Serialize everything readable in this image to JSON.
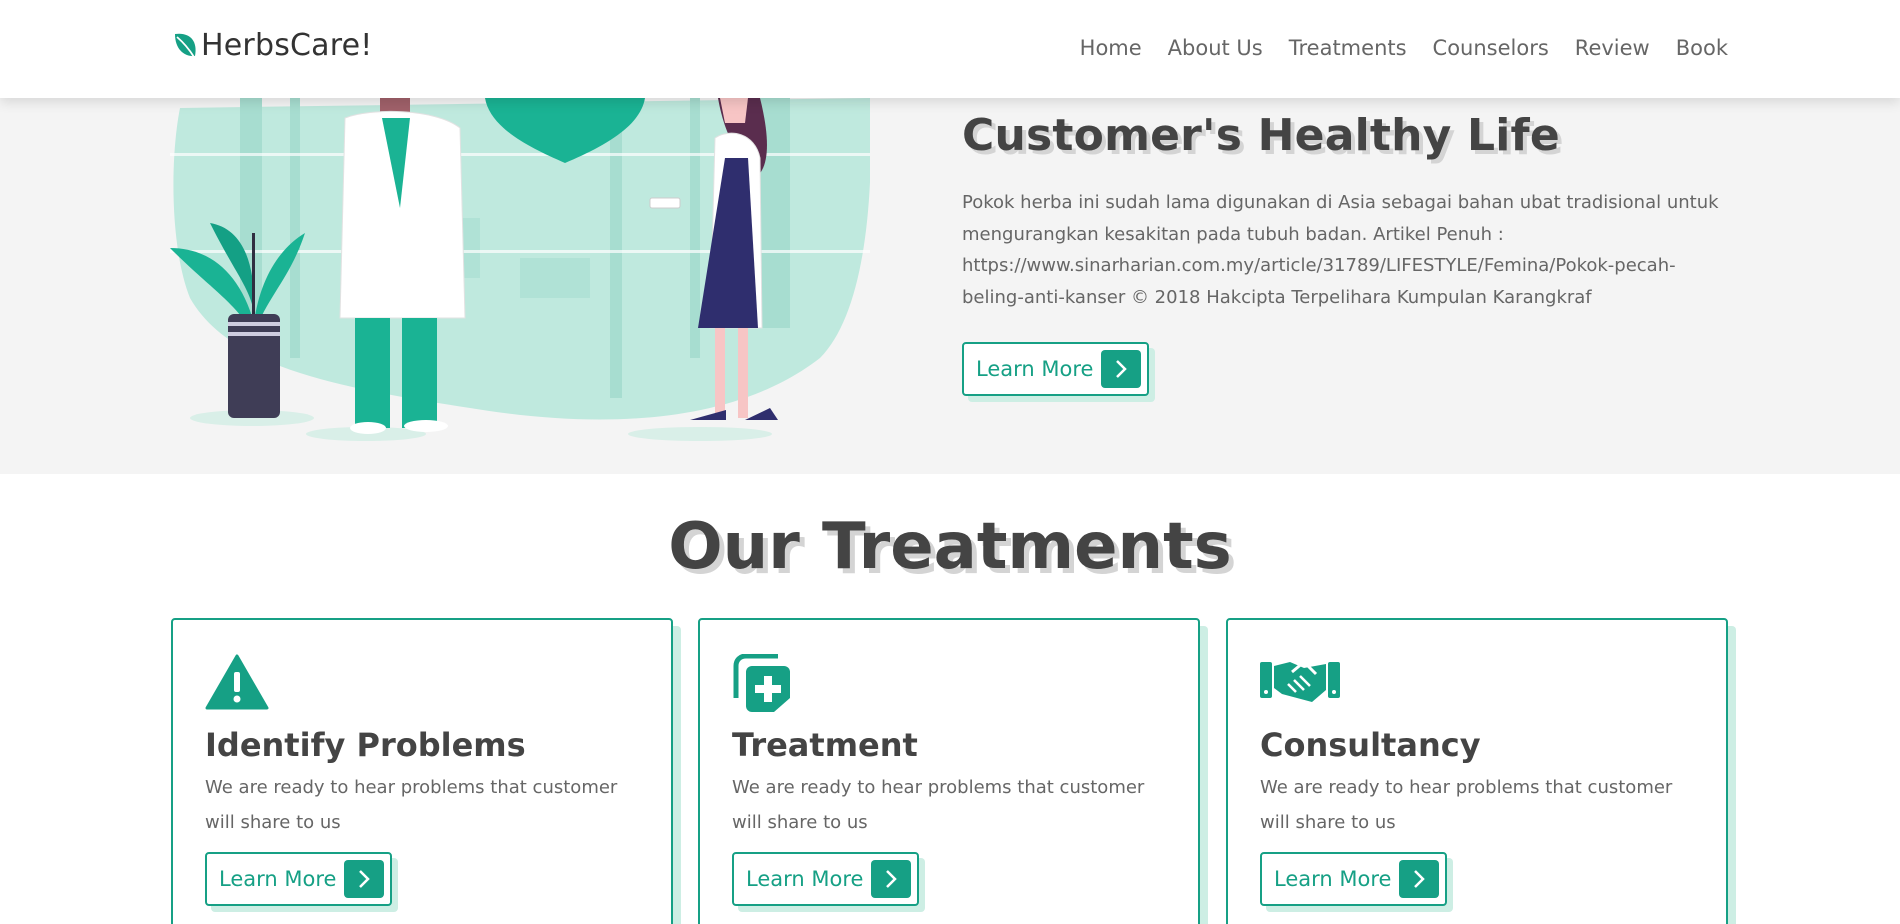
{
  "header": {
    "logo_text": "HerbsCare!",
    "nav": [
      "Home",
      "About Us",
      "Treatments",
      "Counselors",
      "Review",
      "Book"
    ]
  },
  "hero": {
    "title": "Customer's Healthy Life",
    "body": "Pokok herba ini sudah lama digunakan di Asia sebagai bahan ubat tradisional untuk mengurangkan kesakitan pada tubuh badan. Artikel Penuh : https://www.sinarharian.com.my/article/31789/LIFESTYLE/Femina/Pokok-pecah-beling-anti-kanser © 2018 Hakcipta Terpelihara Kumpulan Karangkraf",
    "button_label": "Learn More"
  },
  "treatments": {
    "title": "Our Treatments",
    "cards": [
      {
        "icon": "warning-triangle-icon",
        "title": "Identify Problems",
        "desc": "We are ready to hear problems that customer will share to us",
        "button_label": "Learn More"
      },
      {
        "icon": "medical-kit-icon",
        "title": "Treatment",
        "desc": "We are ready to hear problems that customer will share to us",
        "button_label": "Learn More"
      },
      {
        "icon": "handshake-icon",
        "title": "Consultancy",
        "desc": "We are ready to hear problems that customer will share to us",
        "button_label": "Learn More"
      }
    ]
  },
  "colors": {
    "accent": "#16a085",
    "accent_light": "#cdeee4",
    "hero_bg": "#f4f4f4",
    "text_dark": "#444444"
  }
}
